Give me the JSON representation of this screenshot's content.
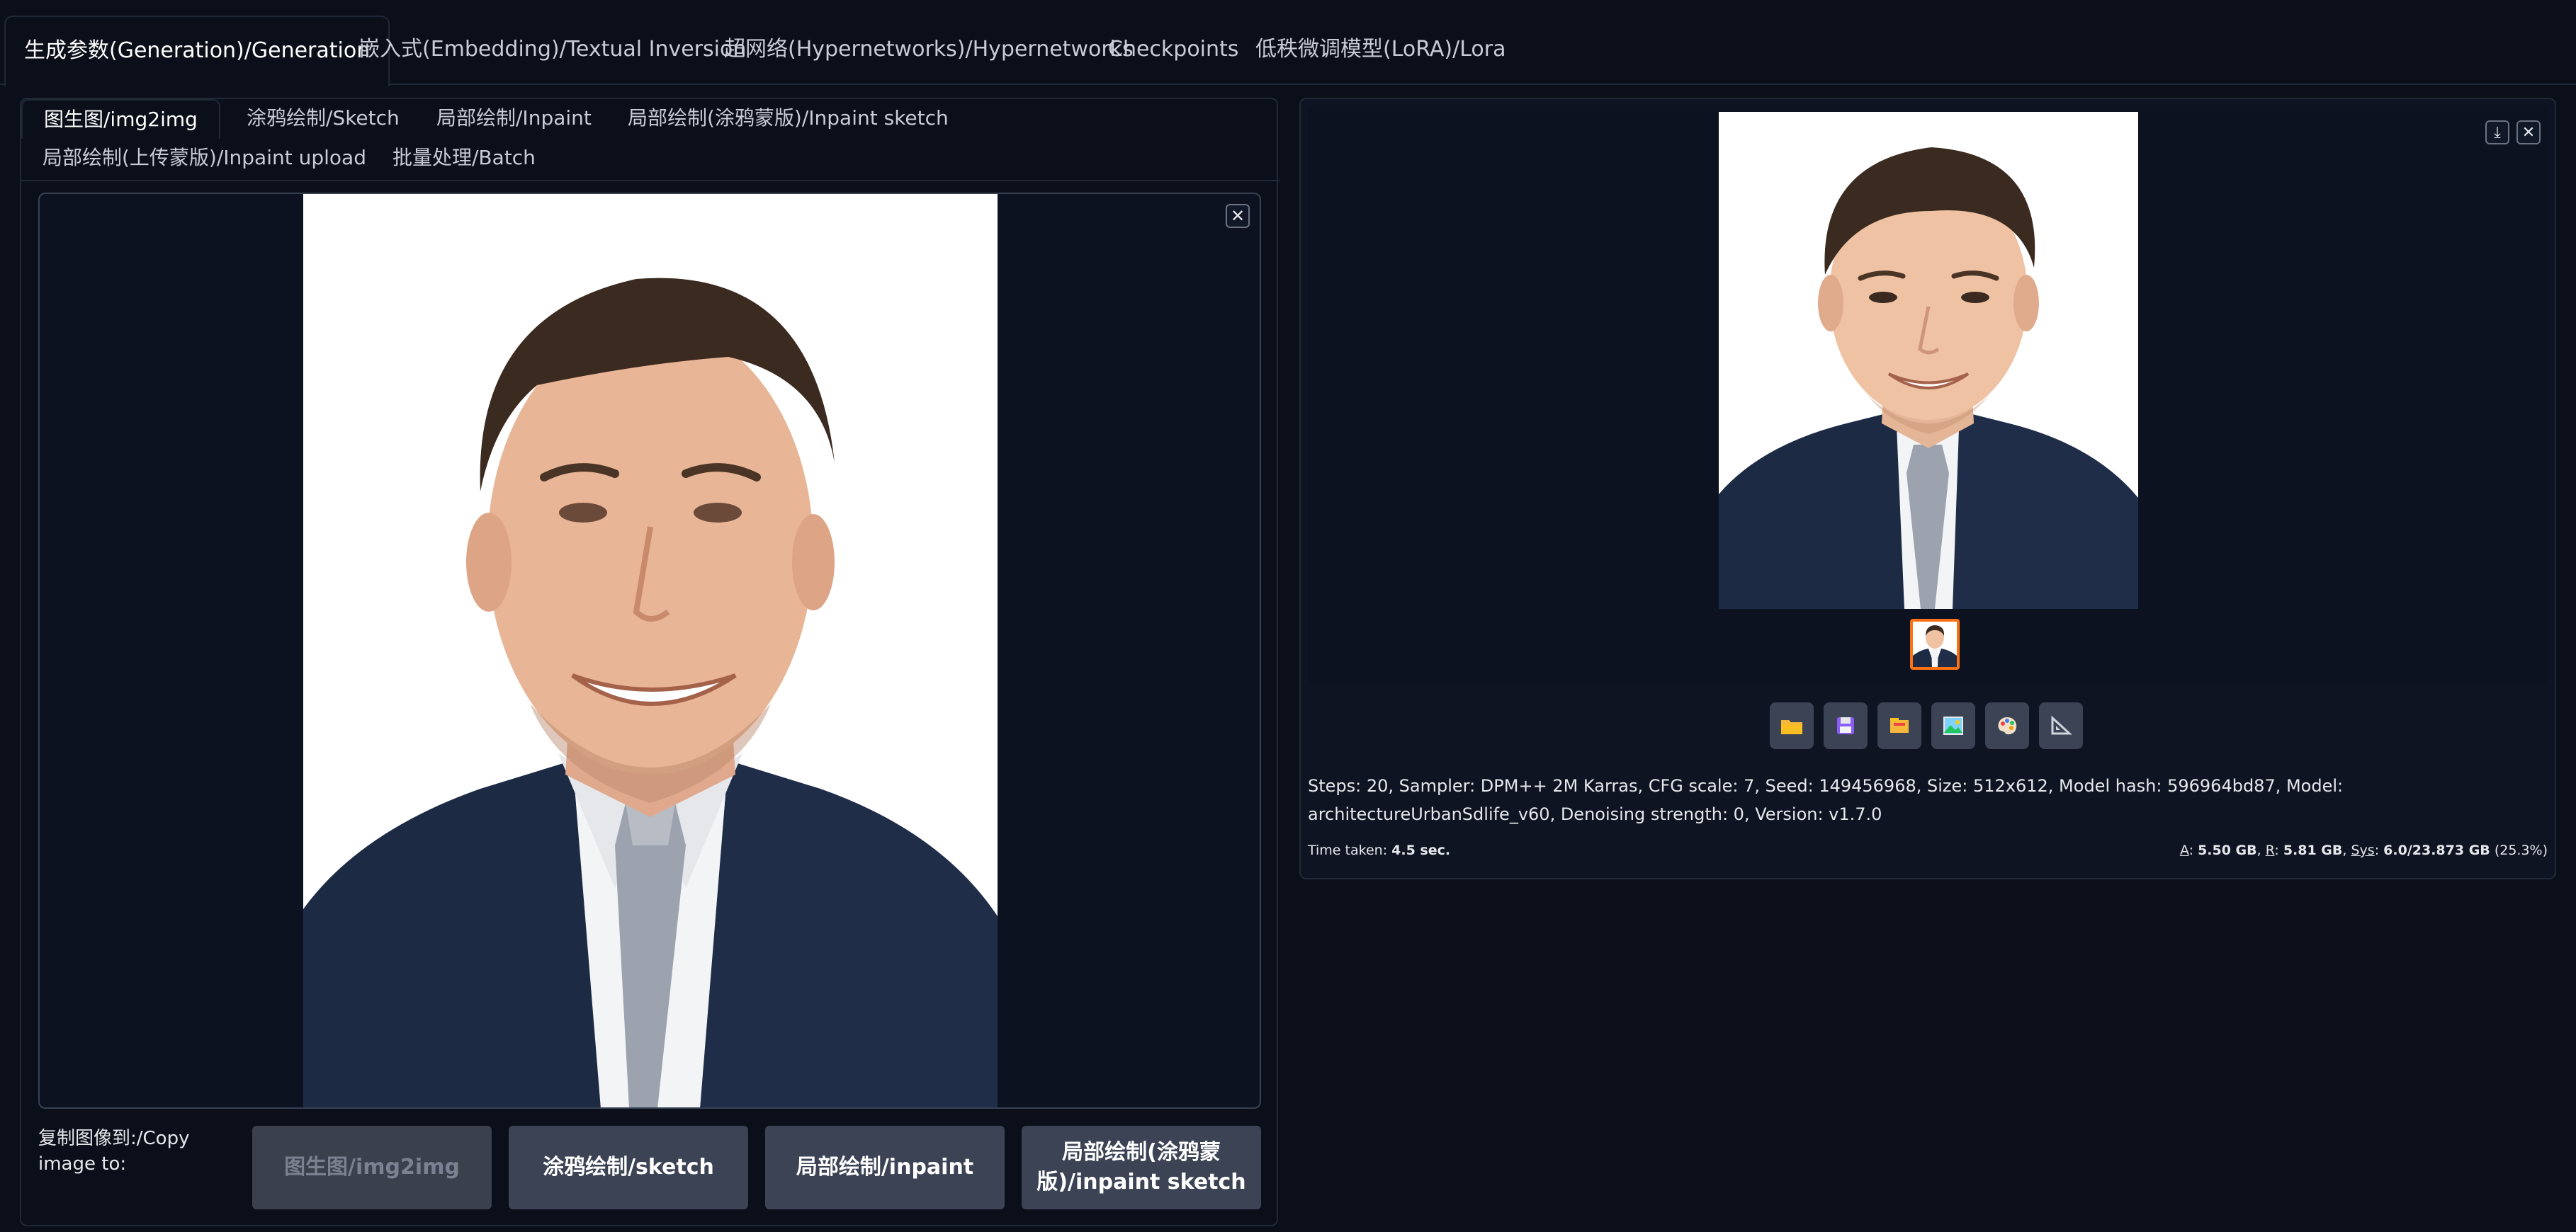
{
  "top_tabs": [
    {
      "label": "生成参数(Generation)/Generation",
      "active": true
    },
    {
      "label": "嵌入式(Embedding)/Textual Inversion",
      "active": false
    },
    {
      "label": "超网络(Hypernetworks)/Hypernetworks",
      "active": false
    },
    {
      "label": "Checkpoints",
      "active": false
    },
    {
      "label": "低秩微调模型(LoRA)/Lora",
      "active": false
    }
  ],
  "sub_tabs": [
    {
      "label": "图生图/img2img",
      "active": true
    },
    {
      "label": "涂鸦绘制/Sketch",
      "active": false
    },
    {
      "label": "局部绘制/Inpaint",
      "active": false
    },
    {
      "label": "局部绘制(涂鸦蒙版)/Inpaint sketch",
      "active": false
    },
    {
      "label": "局部绘制(上传蒙版)/Inpaint upload",
      "active": false
    },
    {
      "label": "批量处理/Batch",
      "active": false
    }
  ],
  "input_image": {
    "close_glyph": "✕",
    "icon": "close-icon"
  },
  "copy": {
    "label": "复制图像到:/Copy image to:",
    "buttons": [
      {
        "label": "图生图/img2img",
        "disabled": true
      },
      {
        "label": "涂鸦绘制/sketch",
        "disabled": false
      },
      {
        "label": "局部绘制/inpaint",
        "disabled": false
      },
      {
        "label": "局部绘制(涂鸦蒙版)/inpaint sketch",
        "disabled": false
      }
    ]
  },
  "gallery": {
    "download_glyph": "⤓",
    "close_glyph": "✕",
    "selected_index": 0
  },
  "tools": [
    {
      "name": "folder-icon"
    },
    {
      "name": "save-icon"
    },
    {
      "name": "zip-icon"
    },
    {
      "name": "send-to-img2img-icon"
    },
    {
      "name": "send-to-inpaint-icon"
    },
    {
      "name": "send-to-extras-icon"
    }
  ],
  "generation_info": "Steps: 20, Sampler: DPM++ 2M Karras, CFG scale: 7, Seed: 149456968, Size: 512x612, Model hash: 596964bd87, Model: architectureUrbanSdlife_v60, Denoising strength: 0, Version: v1.7.0",
  "time": {
    "label": "Time taken:",
    "value": "4.5 sec."
  },
  "vram": {
    "a_label": "A",
    "a_value": "5.50 GB",
    "r_label": "R",
    "r_value": "5.81 GB",
    "sys_label": "Sys",
    "sys_value": "6.0/23.873 GB",
    "percent": "(25.3%)"
  },
  "colors": {
    "background": "#0b0f19",
    "accent": "#f97316",
    "button": "#3b4354"
  }
}
